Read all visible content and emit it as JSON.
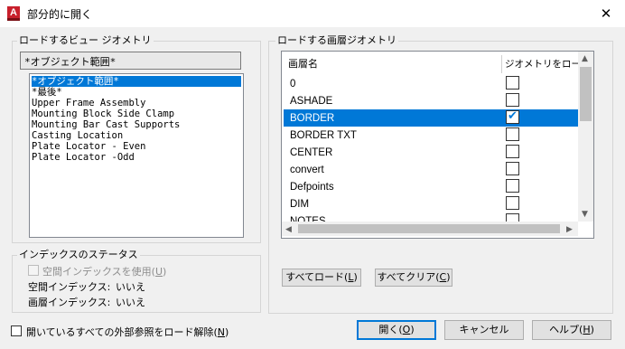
{
  "window": {
    "title": "部分的に開く",
    "app_icon_letter": "A",
    "close_glyph": "✕"
  },
  "load_view": {
    "group_label": "ロードするビュー ジオメトリ",
    "selected_view": "*オブジェクト範囲*",
    "views": [
      {
        "label": "*オブジェクト範囲*",
        "selected": true
      },
      {
        "label": "*最後*",
        "selected": false
      },
      {
        "label": "Upper Frame Assembly",
        "selected": false
      },
      {
        "label": "Mounting Block Side Clamp",
        "selected": false
      },
      {
        "label": "Mounting Bar Cast Supports",
        "selected": false
      },
      {
        "label": "Casting Location",
        "selected": false
      },
      {
        "label": "Plate Locator - Even",
        "selected": false
      },
      {
        "label": "Plate Locator -Odd",
        "selected": false
      }
    ]
  },
  "index_status": {
    "group_label": "インデックスのステータス",
    "use_spatial_index_label": "空間インデックスを使用(",
    "use_spatial_index_key": "U",
    "use_spatial_index_suffix": ")",
    "spatial_index_label": "空間インデックス:",
    "spatial_index_value": "いいえ",
    "layer_index_label": "画層インデックス:",
    "layer_index_value": "いいえ"
  },
  "load_layers": {
    "group_label": "ロードする画層ジオメトリ",
    "col_layer_name": "画層名",
    "col_load_geometry": "ジオメトリをロード",
    "layers": [
      {
        "name": "0",
        "load": false,
        "selected": false
      },
      {
        "name": "ASHADE",
        "load": false,
        "selected": false
      },
      {
        "name": "BORDER",
        "load": true,
        "selected": true
      },
      {
        "name": "BORDER TXT",
        "load": false,
        "selected": false
      },
      {
        "name": "CENTER",
        "load": false,
        "selected": false
      },
      {
        "name": "convert",
        "load": false,
        "selected": false
      },
      {
        "name": "Defpoints",
        "load": false,
        "selected": false
      },
      {
        "name": "DIM",
        "load": false,
        "selected": false
      },
      {
        "name": "NOTES",
        "load": false,
        "selected": false
      }
    ],
    "load_all_button": {
      "prefix": "すべてロード(",
      "key": "L",
      "suffix": ")"
    },
    "clear_all_button": {
      "prefix": "すべてクリア(",
      "key": "C",
      "suffix": ")"
    }
  },
  "footer": {
    "unload_xrefs_label": "開いているすべての外部参照をロード解除(",
    "unload_xrefs_key": "N",
    "unload_xrefs_suffix": ")",
    "open_button": {
      "prefix": "開く(",
      "key": "O",
      "suffix": ")"
    },
    "cancel_button": "キャンセル",
    "help_button": {
      "prefix": "ヘルプ(",
      "key": "H",
      "suffix": ")"
    }
  },
  "colors": {
    "accent": "#0078d7",
    "app_icon": "#c8202c",
    "checkmark": "#0078d7"
  }
}
